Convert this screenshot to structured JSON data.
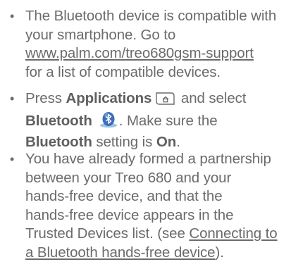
{
  "bullets": [
    {
      "line1": "The Bluetooth device is compatible with",
      "line2": "your smartphone. Go to",
      "link": "www.palm.com/treo680gsm-support",
      "line4": "for a list of compatible devices."
    },
    {
      "press": "Press ",
      "applications": "Applications",
      "and_select": " and select",
      "bluetooth": "Bluetooth",
      "make_sure": ". Make sure the",
      "bluetooth_setting": "Bluetooth",
      "setting_is": " setting is ",
      "on": "On",
      "period": ".",
      "applications_icon": "applications-icon",
      "bluetooth_icon": "bluetooth-icon"
    },
    {
      "line1": "You have already formed a partnership",
      "line2": "between your Treo 680 and your",
      "line3": "hands-free device, and that the",
      "line4": "hands-free device appears in the",
      "line5_pre": "Trusted Devices list. (see ",
      "link_part1": "Connecting to",
      "link_part2": "a Bluetooth hands-free device",
      "line6_post": ")."
    }
  ],
  "bullet_symbol": "•",
  "colors": {
    "text": "#6b6b6b",
    "bluetooth_blue": "#3d6fb6"
  }
}
